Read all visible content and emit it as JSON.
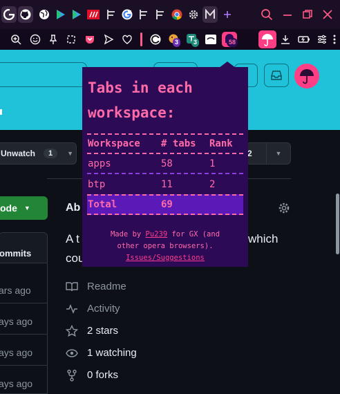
{
  "tabs": [
    {
      "icon": "google-icon"
    },
    {
      "icon": "github-icon"
    },
    {
      "icon": "globe-icon"
    },
    {
      "icon": "play-store-icon"
    },
    {
      "icon": "play-store-icon"
    },
    {
      "icon": "news-icon"
    },
    {
      "icon": "google-icon"
    },
    {
      "icon": "tree-icon"
    },
    {
      "icon": "tree-icon"
    },
    {
      "icon": "chrome-icon"
    },
    {
      "icon": "gear-icon"
    },
    {
      "icon": "workspace-m-icon"
    },
    {
      "icon": "plus-icon"
    }
  ],
  "window_controls": [
    "search-icon",
    "minimize-icon",
    "restore-icon",
    "close-icon"
  ],
  "toolbar": {
    "badges": {
      "extension_a": "3",
      "extension_b": "3",
      "extension_c": "58"
    }
  },
  "github": {
    "watch_label": "Unwatch",
    "watch_count": "1",
    "fork_count_fragment": "2",
    "code_label": "ode",
    "about_fragment": "Ab",
    "description_left": "A t",
    "description_right": "which",
    "description_line2": "cou",
    "commits_label": "ommits",
    "history": [
      "ars ago",
      "ays ago",
      "ays ago",
      "ays ago"
    ],
    "sidebar": [
      {
        "icon": "book-icon",
        "label": "Readme"
      },
      {
        "icon": "pulse-icon",
        "label": "Activity"
      },
      {
        "icon": "star-icon",
        "label": "2 stars"
      },
      {
        "icon": "eye-icon",
        "label": "1 watching"
      },
      {
        "icon": "fork-icon",
        "label": "0 forks"
      }
    ]
  },
  "popup": {
    "title_line1": "Tabs in each",
    "title_line2": "workspace:",
    "columns": [
      "Workspace",
      "# tabs",
      "Rank"
    ],
    "rows": [
      {
        "workspace": "apps",
        "tabs": "58",
        "rank": "1"
      },
      {
        "workspace": "btp",
        "tabs": "11",
        "rank": "2"
      }
    ],
    "total_label": "Total",
    "total_value": "69",
    "footer_prefix": "Made by ",
    "footer_author": "Pu239",
    "footer_suffix": " for GX (and",
    "footer_line2": "other opera browsers).",
    "footer_link": "Issues/Suggestions"
  },
  "colors": {
    "accent_pink": "#ff6ba8",
    "popup_bg": "#2d0a55",
    "header_cyan": "#1fc2d9",
    "code_green": "#238636"
  }
}
